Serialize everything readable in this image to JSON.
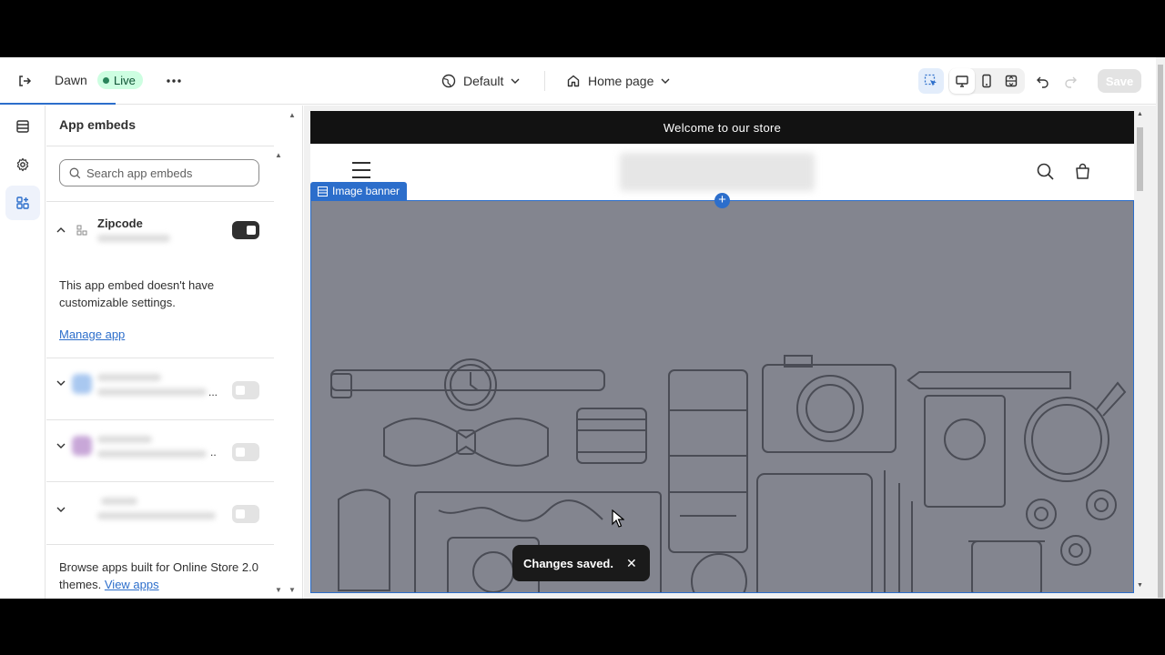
{
  "topbar": {
    "theme_name": "Dawn",
    "status_badge": "Live",
    "preset_dropdown": "Default",
    "page_dropdown": "Home page",
    "save_label": "Save"
  },
  "sidebar": {
    "title": "App embeds",
    "search_placeholder": "Search app embeds",
    "embeds": [
      {
        "name": "Zipcode",
        "expanded": true,
        "enabled": true
      },
      {
        "name": "",
        "expanded": false,
        "enabled": false,
        "truncation": "..."
      },
      {
        "name": "",
        "expanded": false,
        "enabled": false,
        "truncation": ".."
      },
      {
        "name": "",
        "expanded": false,
        "enabled": false
      }
    ],
    "embed_description": "This app embed doesn't have customizable settings.",
    "manage_link": "Manage app",
    "browse_text": "Browse apps built for Online Store 2.0 themes.",
    "browse_link": "View apps"
  },
  "preview": {
    "announcement": "Welcome to our store",
    "section_label": "Image banner"
  },
  "toast": {
    "message": "Changes saved."
  },
  "colors": {
    "accent": "#2c6ecb",
    "live_badge_bg": "#cdfee1",
    "banner_overlay": "#83858f",
    "announcement_bg": "#121212"
  }
}
